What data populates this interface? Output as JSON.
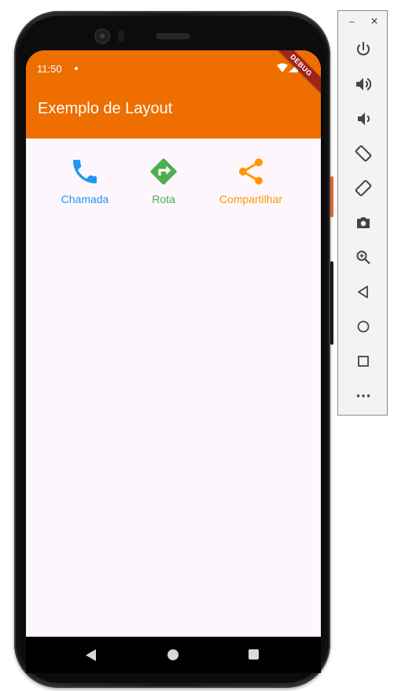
{
  "status_bar": {
    "time": "11:50"
  },
  "debug_banner": "DEBUG",
  "app_bar": {
    "title": "Exemplo de Layout",
    "color": "#ee6e00"
  },
  "actions": [
    {
      "label": "Chamada",
      "icon": "phone-icon",
      "color": "#2196f3"
    },
    {
      "label": "Rota",
      "icon": "directions-icon",
      "color": "#4caf50"
    },
    {
      "label": "Compartilhar",
      "icon": "share-icon",
      "color": "#ff9800"
    }
  ],
  "navigation_bar": [
    "back-icon",
    "home-icon",
    "recents-icon"
  ],
  "emulator_panel": {
    "window_controls": [
      "minimize-icon",
      "close-icon"
    ],
    "buttons": [
      "power-icon",
      "volume-up-icon",
      "volume-down-icon",
      "rotate-left-icon",
      "rotate-right-icon",
      "screenshot-icon",
      "zoom-icon",
      "back-icon",
      "home-icon",
      "overview-icon",
      "more-icon"
    ]
  }
}
